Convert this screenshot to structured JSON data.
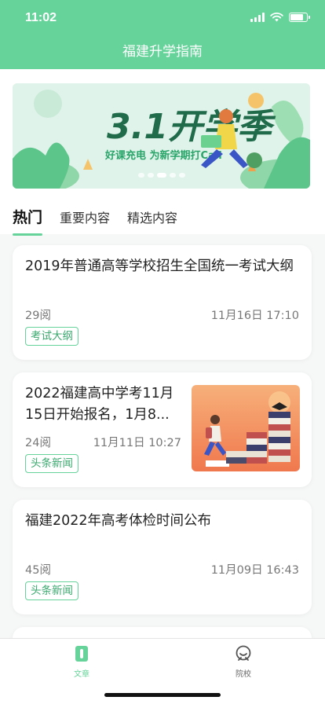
{
  "status_bar": {
    "time": "11:02",
    "battery_level": 0.8
  },
  "header": {
    "title": "福建升学指南"
  },
  "banner": {
    "headline": "3.1开学季",
    "slogan": "好课充电 为新学期打Call",
    "slides_count": 5,
    "active_slide": 3
  },
  "tabs": [
    {
      "label": "热门",
      "active": true
    },
    {
      "label": "重要内容",
      "active": false
    },
    {
      "label": "精选内容",
      "active": false
    }
  ],
  "articles": [
    {
      "title": "2019年普通高等学校招生全国统一考试大纲",
      "reads": "29阅",
      "time": "11月16日 17:10",
      "tag": "考试大纲"
    },
    {
      "title": "2022福建高中学考11月15日开始报名，1月8...",
      "reads": "24阅",
      "time": "11月11日 10:27",
      "tag": "头条新闻"
    },
    {
      "title": "福建2022年高考体检时间公布",
      "reads": "45阅",
      "time": "11月09日 16:43",
      "tag": "头条新闻"
    }
  ],
  "tabbar": [
    {
      "label": "文章",
      "icon": "article-icon",
      "active": true
    },
    {
      "label": "院校",
      "icon": "school-icon",
      "active": false
    }
  ],
  "colors": {
    "primary": "#66d39a",
    "tag_text": "#3aa86e",
    "inactive": "#666666"
  }
}
